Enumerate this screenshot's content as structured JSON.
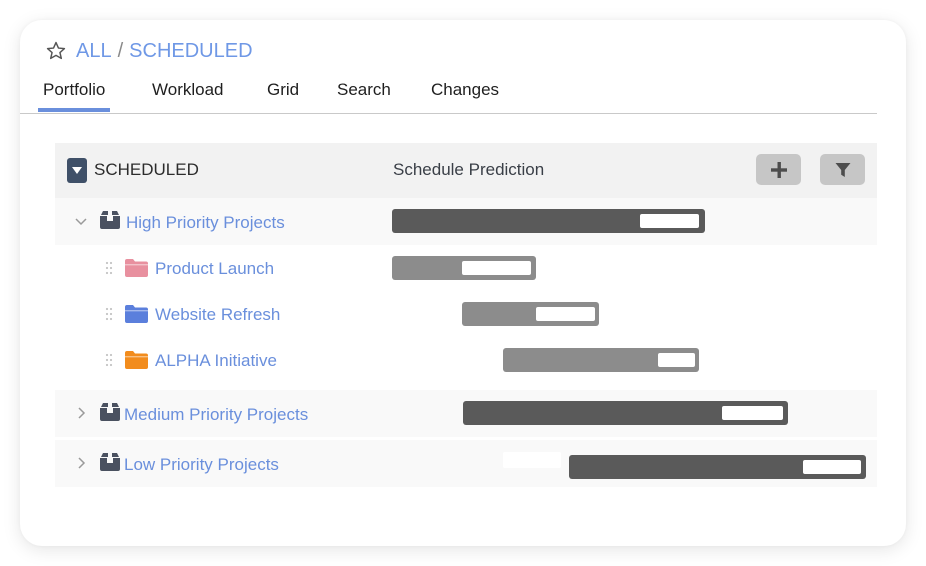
{
  "breadcrumb": {
    "icon": "star-outline-icon",
    "root": "ALL",
    "separator": "/",
    "current": "SCHEDULED"
  },
  "tabs": [
    {
      "label": "Portfolio",
      "active": true
    },
    {
      "label": "Workload",
      "active": false
    },
    {
      "label": "Grid",
      "active": false
    },
    {
      "label": "Search",
      "active": false
    },
    {
      "label": "Changes",
      "active": false
    }
  ],
  "colors": {
    "accent": "#6a8fdc",
    "header_bg": "#f2f2f2",
    "group_bg": "#f9f9f9",
    "bar_dark": "#5a5a5a",
    "bar_light": "#8c8c8c",
    "folder_pink": "#e8909f",
    "folder_blue": "#5b7fdc",
    "folder_orange": "#f28c1d",
    "icon_dark": "#4a5160"
  },
  "grid": {
    "header": {
      "title": "SCHEDULED",
      "column": "Schedule Prediction",
      "add_button": "plus-icon",
      "filter_button": "filter-icon"
    },
    "timeline_range": [
      0,
      100
    ],
    "rows": [
      {
        "type": "group",
        "label": "High Priority Projects",
        "expanded": true,
        "bar": {
          "start": 0,
          "end": 65.8,
          "remaining_start": 52.3,
          "remaining_end": 64.7
        }
      },
      {
        "type": "project",
        "label": "Product Launch",
        "folder_color": "#e8909f",
        "bar": {
          "start": 0,
          "end": 30.3,
          "remaining_start": 14.7,
          "remaining_end": 29.3
        }
      },
      {
        "type": "project",
        "label": "Website Refresh",
        "folder_color": "#5b7fdc",
        "bar": {
          "start": 14.7,
          "end": 43.6,
          "remaining_start": 30.3,
          "remaining_end": 42.7
        }
      },
      {
        "type": "project",
        "label": "ALPHA Initiative",
        "folder_color": "#f28c1d",
        "bar": {
          "start": 23.4,
          "end": 64.6,
          "remaining_start": 56.0,
          "remaining_end": 63.7
        }
      },
      {
        "type": "group",
        "label": "Medium Priority Projects",
        "expanded": false,
        "bar": {
          "start": 14.9,
          "end": 83.4,
          "remaining_start": 69.5,
          "remaining_end": 82.3
        }
      },
      {
        "type": "group",
        "label": "Low Priority Projects",
        "expanded": false,
        "bar": {
          "start": 37.2,
          "end": 99.8,
          "remaining_start": 86.6,
          "remaining_end": 98.7
        },
        "ghost": {
          "start": 23.4,
          "end": 35.6
        }
      }
    ]
  }
}
